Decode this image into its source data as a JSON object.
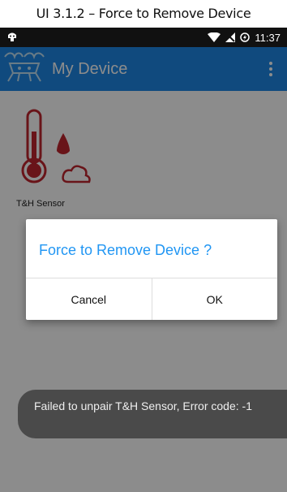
{
  "caption": "UI 3.1.2 – Force to Remove Device",
  "status_bar": {
    "time": "11:37"
  },
  "app_bar": {
    "title": "My Device",
    "icons": [
      "app-logo-icon",
      "overflow-menu-icon"
    ]
  },
  "device": {
    "label": "T&H Sensor",
    "icon": "thermometer-humidity-icon"
  },
  "dialog": {
    "title": "Force to Remove Device ?",
    "cancel_label": "Cancel",
    "ok_label": "OK"
  },
  "toast": {
    "message": "Failed to unpair T&H Sensor, Error code: -1"
  },
  "colors": {
    "app_bar": "#1e88e5",
    "dialog_title": "#2196f3",
    "icon_red": "#c0262f"
  }
}
